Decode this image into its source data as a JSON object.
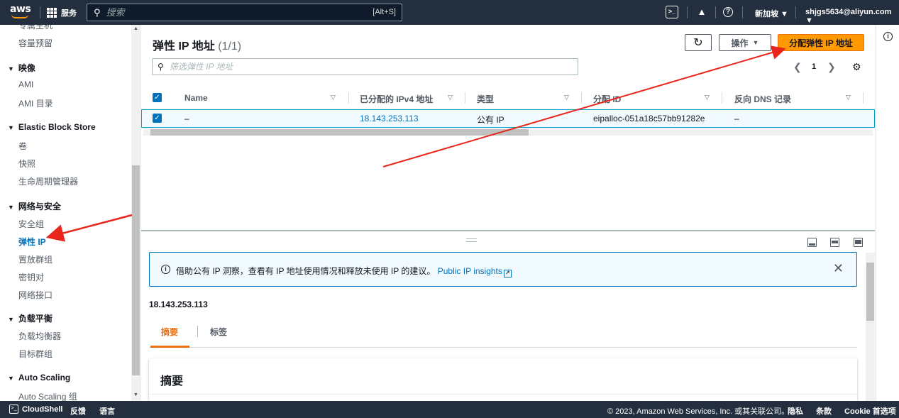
{
  "topbar": {
    "logo": "aws",
    "services_label": "服务",
    "search_placeholder": "搜索",
    "search_shortcut": "[Alt+S]",
    "region": "新加坡 ▼",
    "account": "shjgs5634@aliyun.com ▼"
  },
  "sidebar": {
    "items": [
      {
        "type": "item",
        "label": "专属主机"
      },
      {
        "type": "item",
        "label": "容量预留"
      },
      {
        "type": "head",
        "label": "映像"
      },
      {
        "type": "item",
        "label": "AMI"
      },
      {
        "type": "item",
        "label": "AMI 目录"
      },
      {
        "type": "head",
        "label": "Elastic Block Store"
      },
      {
        "type": "item",
        "label": "卷"
      },
      {
        "type": "item",
        "label": "快照"
      },
      {
        "type": "item",
        "label": "生命周期管理器"
      },
      {
        "type": "head",
        "label": "网络与安全"
      },
      {
        "type": "item",
        "label": "安全组"
      },
      {
        "type": "item",
        "label": "弹性 IP",
        "active": true
      },
      {
        "type": "item",
        "label": "置放群组"
      },
      {
        "type": "item",
        "label": "密钥对"
      },
      {
        "type": "item",
        "label": "网络接口"
      },
      {
        "type": "head",
        "label": "负载平衡"
      },
      {
        "type": "item",
        "label": "负载均衡器"
      },
      {
        "type": "item",
        "label": "目标群组"
      },
      {
        "type": "head",
        "label": "Auto Scaling"
      },
      {
        "type": "item",
        "label": "Auto Scaling 组"
      }
    ]
  },
  "main": {
    "title": "弹性 IP 地址",
    "count": "(1/1)",
    "actions_label": "操作",
    "allocate_label": "分配弹性 IP 地址",
    "filter_placeholder": "筛选弹性 IP 地址",
    "page": "1",
    "columns": [
      "Name",
      "已分配的 IPv4 地址",
      "类型",
      "分配 ID",
      "反向 DNS 记录"
    ],
    "row": {
      "name": "–",
      "ipv4": "18.143.253.113",
      "type": "公有 IP",
      "allocation_id": "eipalloc-051a18c57bb91282e",
      "reverse_dns": "–"
    }
  },
  "detail": {
    "info_text": "借助公有 IP 洞察，查看有 IP 地址使用情况和释放未使用 IP 的建议。",
    "info_link": "Public IP insights",
    "ip": "18.143.253.113",
    "tab_summary": "摘要",
    "tab_tags": "标签",
    "section_title": "摘要"
  },
  "footer": {
    "cloudshell": "CloudShell",
    "feedback": "反馈",
    "language": "语言",
    "copyright": "© 2023, Amazon Web Services, Inc. 或其关联公司。",
    "privacy": "隐私",
    "terms": "条款",
    "cookie": "Cookie 首选项"
  },
  "colors": {
    "primary": "#ff9900",
    "link": "#0073bb",
    "nav_bg": "#232f3e",
    "annotation": "#e8261c"
  }
}
